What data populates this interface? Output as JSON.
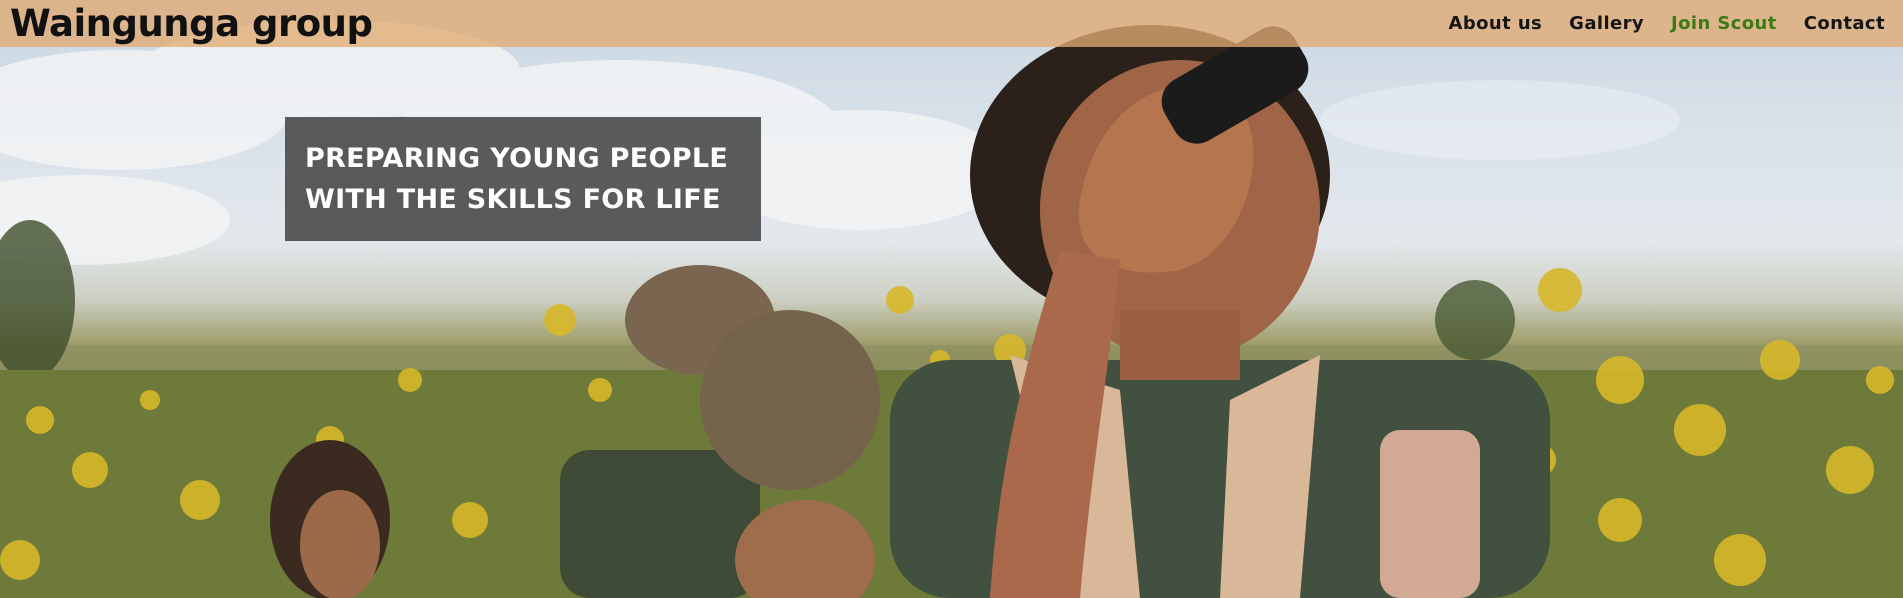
{
  "site": {
    "brand": "Waingunga group"
  },
  "nav": {
    "items": [
      {
        "label": "About us",
        "active": false
      },
      {
        "label": "Gallery",
        "active": false
      },
      {
        "label": "Join Scout",
        "active": true
      },
      {
        "label": "Contact",
        "active": false
      }
    ]
  },
  "hero": {
    "tagline_line1": "PREPARING YOUNG PEOPLE",
    "tagline_line2": "WITH THE SKILLS FOR LIFE",
    "image_subject": "scouts-in-wildflower-meadow-photo"
  },
  "colors": {
    "navbar_bg": "#E2AA73",
    "active_nav": "#3D7A16",
    "tagline_bg": "#464646",
    "tagline_text": "#FFFFFF"
  }
}
